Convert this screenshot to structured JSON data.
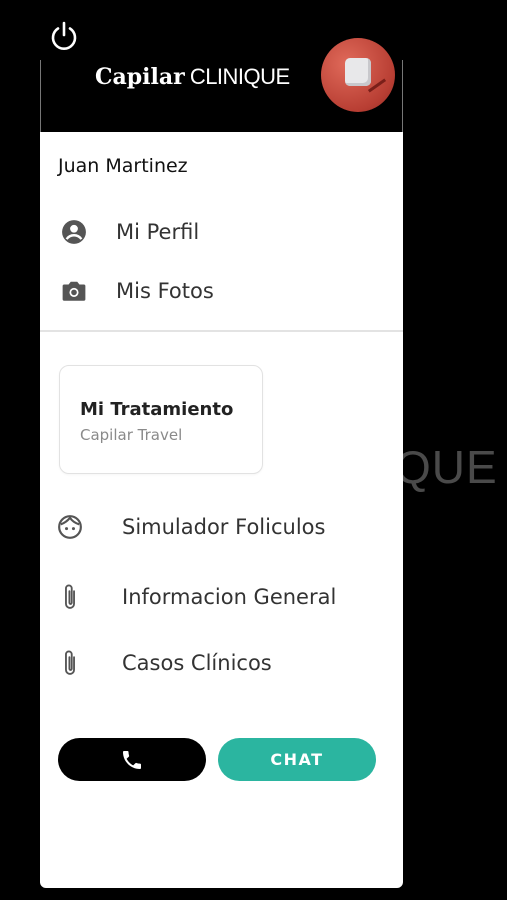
{
  "background": {
    "text": "QUE"
  },
  "header": {
    "brand_bold": "Capilar",
    "brand_light": "CLINIQUE"
  },
  "user": {
    "name": "Juan Martinez"
  },
  "menu": [
    {
      "label": "Mi Perfil",
      "icon": "account-circle-icon"
    },
    {
      "label": "Mis Fotos",
      "icon": "camera-icon"
    }
  ],
  "treatment": {
    "title": "Mi Tratamiento",
    "subtitle": "Capilar Travel"
  },
  "links": [
    {
      "label": "Simulador Foliculos",
      "icon": "face-icon"
    },
    {
      "label": "Informacion General",
      "icon": "paperclip-icon"
    },
    {
      "label": "Casos Clínicos",
      "icon": "paperclip-icon"
    }
  ],
  "actions": {
    "chat_label": "CHAT"
  },
  "colors": {
    "accent": "#2bb5a0",
    "header_bg": "#000000",
    "avatar": "#c0453a"
  }
}
